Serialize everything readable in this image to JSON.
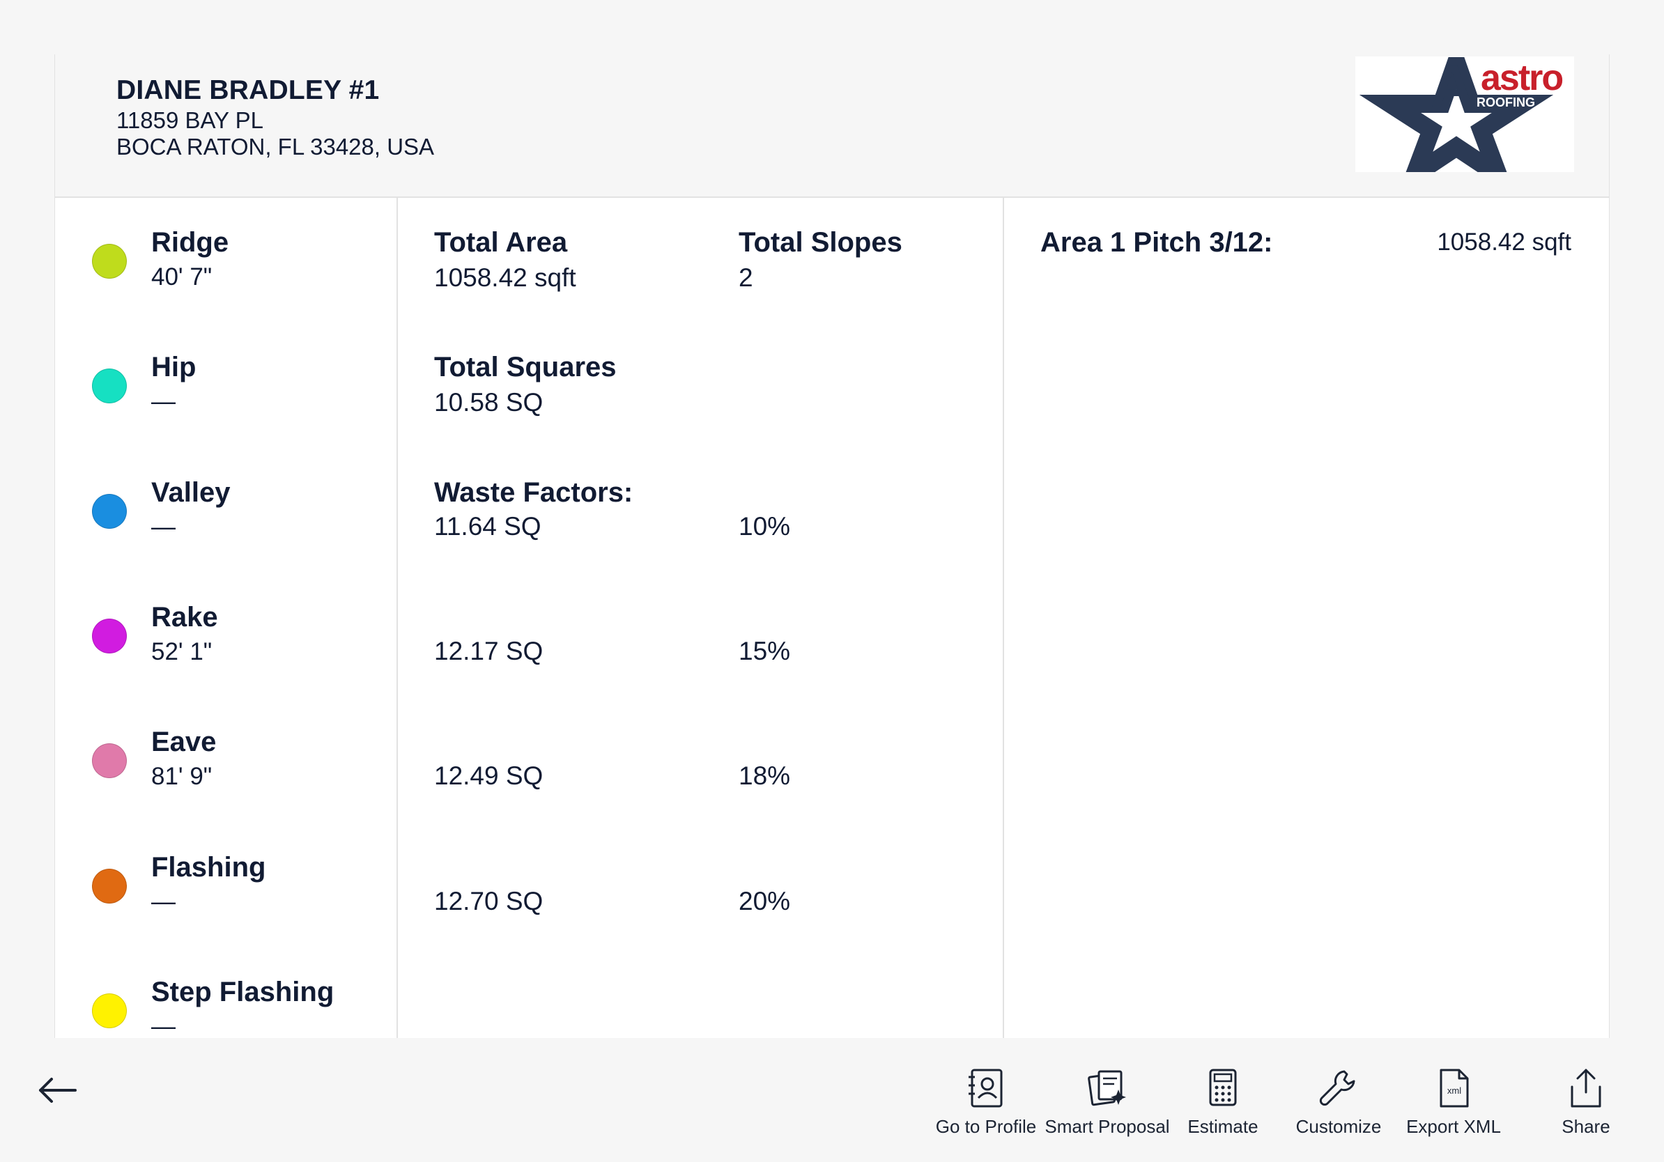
{
  "header": {
    "client_name": "DIANE BRADLEY #1",
    "address_line1": "11859 BAY PL",
    "address_line2": "BOCA RATON, FL 33428, USA",
    "logo": {
      "letter": "A",
      "word": "astro",
      "tagline": "ROOFING",
      "star_color": "#2b3a55",
      "word_color": "#c8202b"
    }
  },
  "line_items": [
    {
      "label": "Ridge",
      "value": "40' 7\"",
      "color": "#bfdc1c"
    },
    {
      "label": "Hip",
      "value": "—",
      "color": "#16e0c2"
    },
    {
      "label": "Valley",
      "value": "—",
      "color": "#1a8ee0"
    },
    {
      "label": "Rake",
      "value": "52' 1\"",
      "color": "#d11ce0"
    },
    {
      "label": "Eave",
      "value": "81' 9\"",
      "color": "#e07aaa"
    },
    {
      "label": "Flashing",
      "value": "—",
      "color": "#e06a12"
    },
    {
      "label": "Step Flashing",
      "value": "—",
      "color": "#fff200"
    }
  ],
  "metrics": {
    "total_area_label": "Total Area",
    "total_area_value": "1058.42 sqft",
    "total_slopes_label": "Total Slopes",
    "total_slopes_value": "2",
    "total_squares_label": "Total Squares",
    "total_squares_value": "10.58 SQ",
    "waste_factors_label": "Waste Factors:",
    "waste_factors": [
      {
        "squares": "11.64 SQ",
        "percent": "10%"
      },
      {
        "squares": "12.17 SQ",
        "percent": "15%"
      },
      {
        "squares": "12.49 SQ",
        "percent": "18%"
      },
      {
        "squares": "12.70 SQ",
        "percent": "20%"
      }
    ]
  },
  "areas": [
    {
      "label": "Area 1 Pitch 3/12:",
      "value": "1058.42 sqft"
    }
  ],
  "toolbar": {
    "back_icon": "arrow-left-icon",
    "actions": [
      {
        "label": "Go to Profile",
        "icon": "profile-book-icon"
      },
      {
        "label": "Smart Proposal",
        "icon": "smart-proposal-icon"
      },
      {
        "label": "Estimate",
        "icon": "calculator-icon"
      },
      {
        "label": "Customize",
        "icon": "wrench-icon"
      },
      {
        "label": "Export XML",
        "icon": "xml-file-icon"
      },
      {
        "label": "Share",
        "icon": "share-icon"
      }
    ]
  }
}
